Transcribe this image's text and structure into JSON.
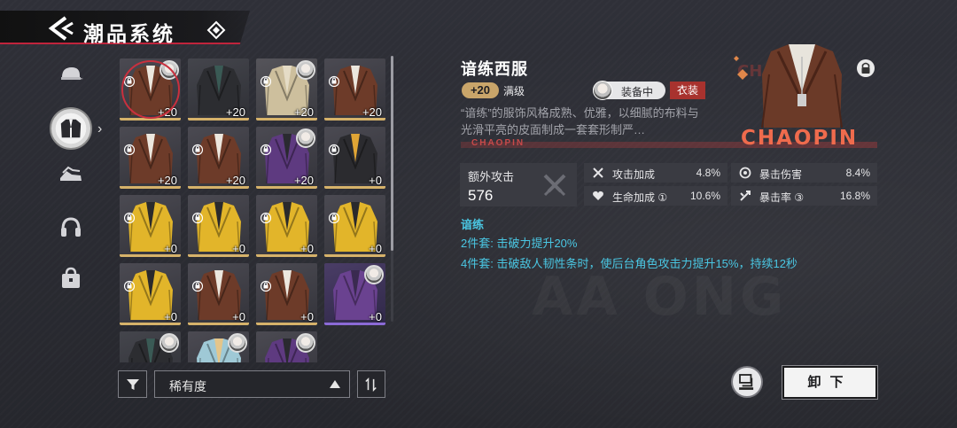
{
  "header": {
    "title": "潮品系统"
  },
  "nav": {
    "items": [
      {
        "icon": "cap-icon"
      },
      {
        "icon": "jacket-icon",
        "active": true
      },
      {
        "icon": "sneakers-icon"
      },
      {
        "icon": "headphones-icon"
      },
      {
        "icon": "bag-icon"
      }
    ]
  },
  "grid": {
    "items": [
      {
        "level": "+20",
        "style": "brown",
        "locked": true,
        "selected": true,
        "avatar": true
      },
      {
        "level": "+20",
        "style": "dark",
        "locked": false
      },
      {
        "level": "+20",
        "style": "beige",
        "locked": true,
        "avatar": true
      },
      {
        "level": "+20",
        "style": "brown",
        "locked": true
      },
      {
        "level": "+20",
        "style": "brown",
        "locked": true
      },
      {
        "level": "+20",
        "style": "brown",
        "locked": true
      },
      {
        "level": "+20",
        "style": "purple",
        "locked": true,
        "avatar": true
      },
      {
        "level": "+0",
        "style": "black",
        "locked": true
      },
      {
        "level": "+0",
        "style": "yellow",
        "locked": true
      },
      {
        "level": "+0",
        "style": "yellow",
        "locked": true
      },
      {
        "level": "+0",
        "style": "yellow",
        "locked": true
      },
      {
        "level": "+0",
        "style": "yellow",
        "locked": true
      },
      {
        "level": "+0",
        "style": "yellow",
        "locked": true
      },
      {
        "level": "+0",
        "style": "brown",
        "locked": true
      },
      {
        "level": "+0",
        "style": "brown",
        "locked": true
      },
      {
        "level": "+0",
        "style": "purple2",
        "locked": false,
        "avatar": true
      },
      {
        "level": "",
        "style": "dark",
        "locked": false,
        "avatar": true
      },
      {
        "level": "",
        "style": "teal",
        "locked": false,
        "avatar": true
      },
      {
        "level": "",
        "style": "purple",
        "locked": false,
        "avatar": true
      }
    ]
  },
  "controls": {
    "sort_label": "稀有度"
  },
  "detail": {
    "name": "谙练西服",
    "level": "+20",
    "maxed": "满级",
    "equipped": "装备中",
    "type": "衣装",
    "description": "“谙练”的服饰风格成熟、优雅，以细腻的布料与光滑平亮的皮面制成一套套形制严…",
    "brand_small": "CHAOPIN",
    "brand_big": "CHAOPIN",
    "main_stat": {
      "label": "额外攻击",
      "value": "576"
    },
    "stats": [
      {
        "name": "攻击加成",
        "value": "4.8%",
        "icon": "swords-icon"
      },
      {
        "name": "暴击伤害",
        "value": "8.4%",
        "icon": "target-icon"
      },
      {
        "name": "生命加成 ①",
        "value": "10.6%",
        "icon": "heart-icon"
      },
      {
        "name": "暴击率 ③",
        "value": "16.8%",
        "icon": "crit-icon"
      }
    ],
    "set_name": "谙练",
    "set2": "2件套: 击破力提升20%",
    "set4": "4件套: 击破敌人韧性条时，使后台角色攻击力提升15%，持续12秒"
  },
  "actions": {
    "unequip": "卸下"
  },
  "colors": {
    "accent_red": "#c0243c",
    "set_cyan": "#4ac7e3",
    "level_gold": "#c9a56a",
    "brand_orange": "#ef6b4d"
  }
}
